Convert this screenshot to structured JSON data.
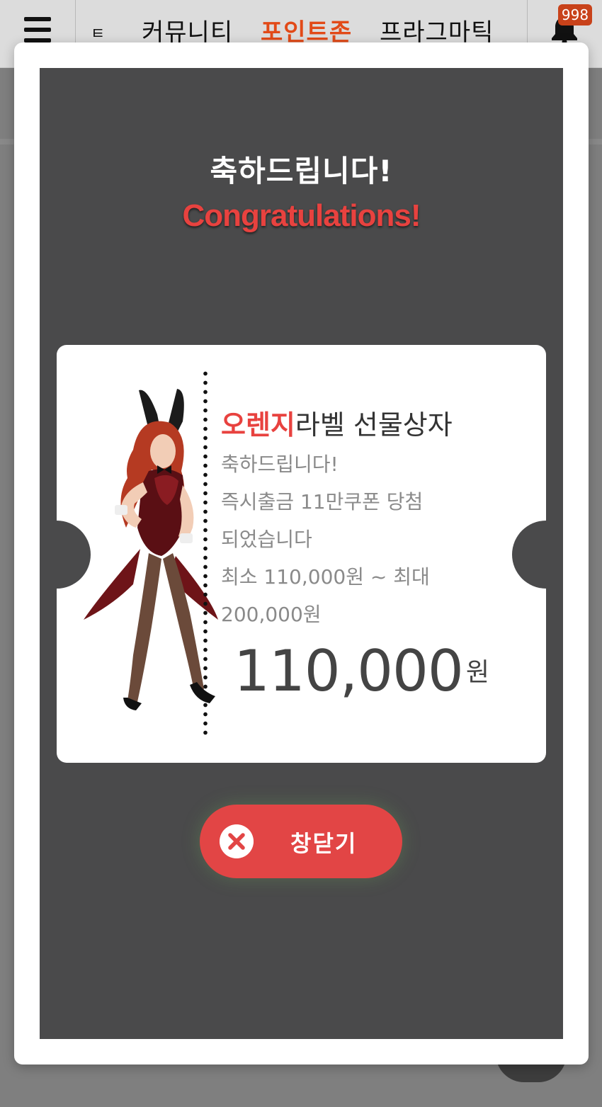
{
  "nav": {
    "partial_label": "ㅌ",
    "items": [
      "커뮤니티",
      "포인트존",
      "프라그마틱"
    ],
    "active_index": 1,
    "notification_count": "998"
  },
  "modal": {
    "title_ko": "축하드립니다!",
    "title_en": "Congratulations!",
    "prize": {
      "name_highlight": "오렌지",
      "name_rest": "라벨 선물상자",
      "desc_lines": [
        "축하드립니다!",
        "즉시출금 11만쿠폰 당첨 되었습니다",
        "최소 110,000원 ~ 최대 200,000원"
      ],
      "amount": "110,000",
      "amount_unit": "원"
    },
    "close_label": "창닫기"
  },
  "colors": {
    "accent_red": "#e8423f",
    "nav_active": "#e24a18",
    "panel_bg": "#4a4a4b"
  }
}
